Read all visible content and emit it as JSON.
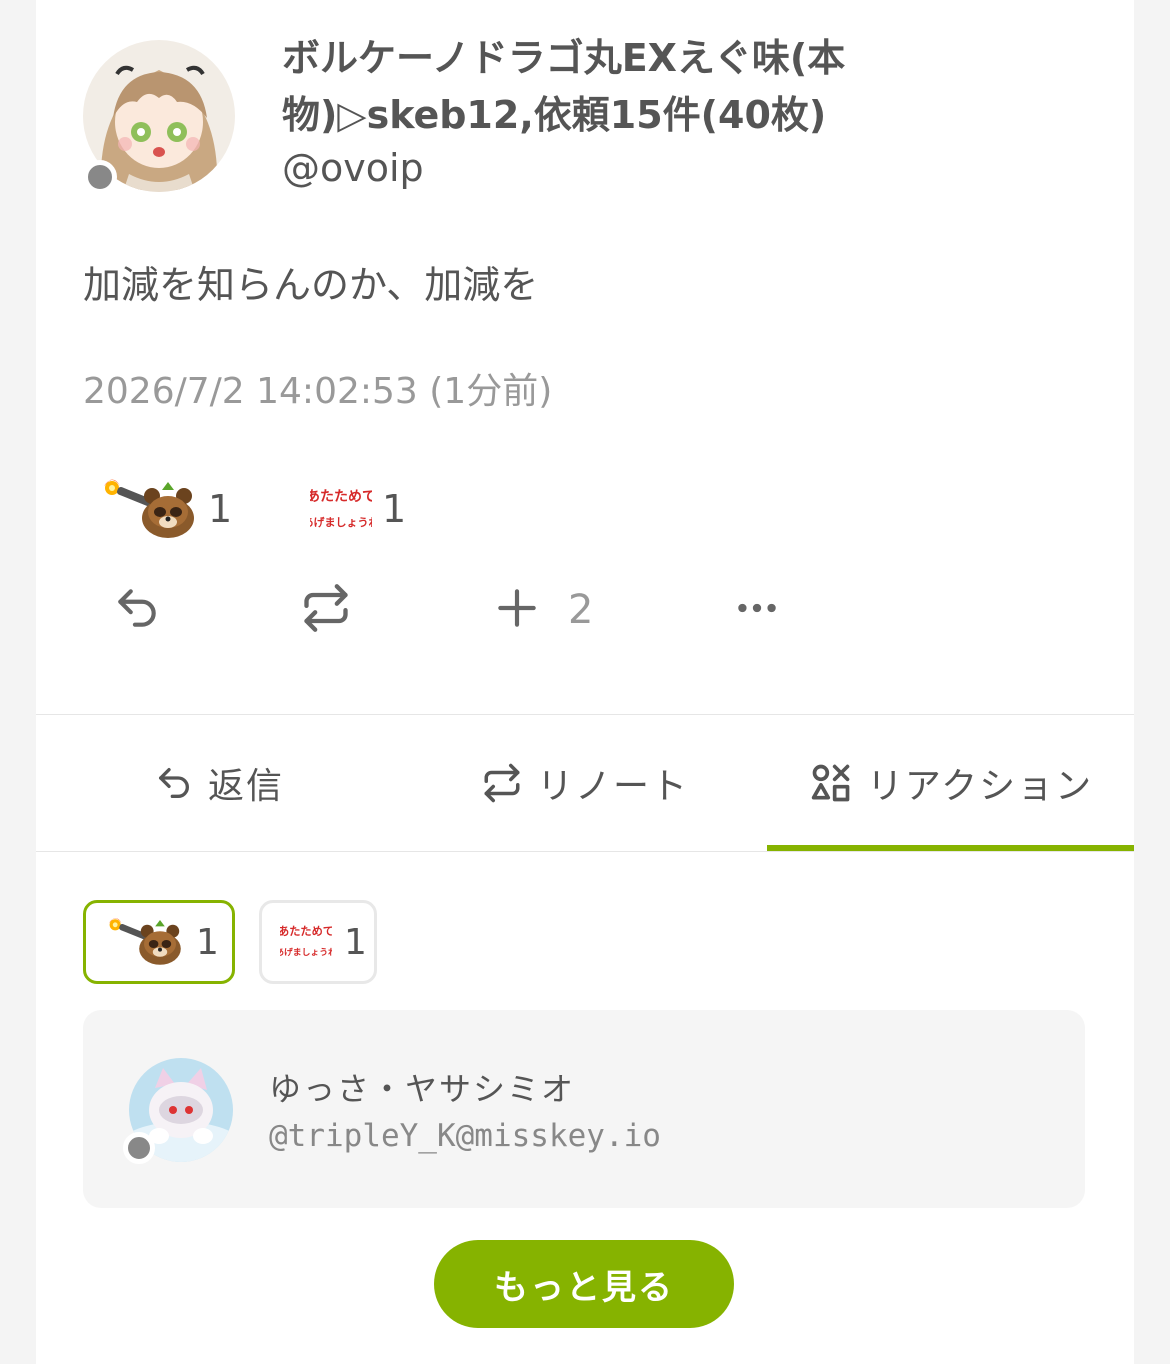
{
  "note": {
    "author": {
      "display_name": "ボルケーノドラゴ丸EXえぐ味(本物)▷skeb12,依頼15件(40枚)",
      "username": "@ovoip"
    },
    "text": "加減を知らんのか、加減を",
    "timestamp": "2026/7/2 14:02:53 (1分前)",
    "reactions": [
      {
        "icon": "tanuki-flamethrower-emoji",
        "count": "1"
      },
      {
        "icon": "atatamete-agemashoune-emoji",
        "text": "あたためて あげましょうね",
        "count": "1"
      }
    ],
    "actions": {
      "reply_icon": "reply-icon",
      "renote_icon": "renote-icon",
      "react_icon": "plus-icon",
      "react_count": "2",
      "more_icon": "more-icon"
    }
  },
  "tabs": [
    {
      "label": "返信",
      "icon": "reply-icon"
    },
    {
      "label": "リノート",
      "icon": "renote-icon"
    },
    {
      "label": "リアクション",
      "icon": "shapes-icon",
      "active": true
    }
  ],
  "reaction_filter": [
    {
      "icon": "tanuki-flamethrower-emoji",
      "count": "1",
      "active": true
    },
    {
      "icon": "atatamete-agemashoune-emoji",
      "text": "あたためて あげましょうね",
      "count": "1",
      "active": false
    }
  ],
  "reactor": {
    "name": "ゆっさ・ヤサシミオ",
    "handle": "@tripleY_K@misskey.io"
  },
  "more_button": "もっと見る",
  "colors": {
    "accent": "#86b300",
    "text": "#555555",
    "muted": "#999999",
    "status": "#888888"
  }
}
